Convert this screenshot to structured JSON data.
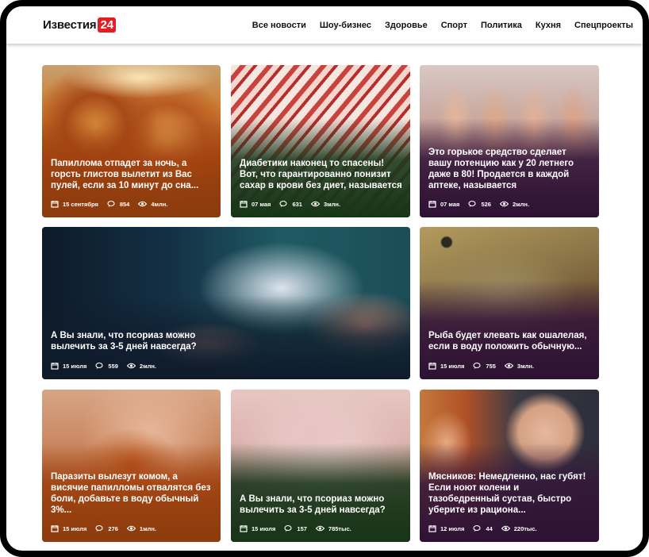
{
  "header": {
    "logo_text": "Известия",
    "logo_badge": "24",
    "brand_color": "#e31e24",
    "nav": [
      {
        "label": "Все новости"
      },
      {
        "label": "Шоу-бизнес"
      },
      {
        "label": "Здоровье"
      },
      {
        "label": "Спорт"
      },
      {
        "label": "Политика"
      },
      {
        "label": "Кухня"
      },
      {
        "label": "Спецпроекты"
      }
    ]
  },
  "icons": {
    "date": "calendar-icon",
    "comments": "comments-icon",
    "views": "eye-icon"
  },
  "cards": [
    {
      "title": "Папиллома отпадет за ночь, а горсть глистов вылетит из Вас пулей, если за 10 минут до сна...",
      "date": "15 сентября",
      "comments": "854",
      "views": "4млн.",
      "image": "jar",
      "overlay": "#8c3c0e"
    },
    {
      "title": "Диабетики наконец то спасены! Вот, что гарантированно понизит сахар в крови без диет, называется",
      "date": "07 мая",
      "comments": "631",
      "views": "3млн.",
      "image": "bacon",
      "overlay": "#173517"
    },
    {
      "title": "Это горькое средство сделает вашу потенцию как у 20 летнего даже в 80! Продается в каждой аптеке, называется",
      "date": "07 мая",
      "comments": "526",
      "views": "2млн.",
      "image": "feet",
      "overlay": "#2e1234"
    },
    {
      "title": "А Вы знали, что псориаз можно вылечить за 3-5 дней навсегда?",
      "date": "15 июля",
      "comments": "559",
      "views": "2млн.",
      "image": "pills",
      "overlay": "#0e1b2b"
    },
    {
      "title": "Рыба будет клевать как ошалелая, если в воду положить обычную...",
      "date": "15 июля",
      "comments": "755",
      "views": "3млн.",
      "image": "fish",
      "overlay": "#2e1234"
    },
    {
      "title": "Паразиты вылезут комом, а висячие папилломы отвалятся без боли, добавьте в воду обычный 3%...",
      "date": "15 июля",
      "comments": "276",
      "views": "1млн.",
      "image": "hand",
      "overlay": "#8c3c0e"
    },
    {
      "title": "А Вы знали, что псориаз можно вылечить за 3-5 дней навсегда?",
      "date": "15 июля",
      "comments": "157",
      "views": "785тыс.",
      "image": "skin",
      "overlay": "#173517"
    },
    {
      "title": "Мясников: Немедленно, нас губят! Если ноют колени и тазобедренный сустав, быстро уберите из рациона...",
      "date": "12 июля",
      "comments": "44",
      "views": "220тыс.",
      "image": "doctor",
      "overlay": "#2e1234"
    }
  ]
}
